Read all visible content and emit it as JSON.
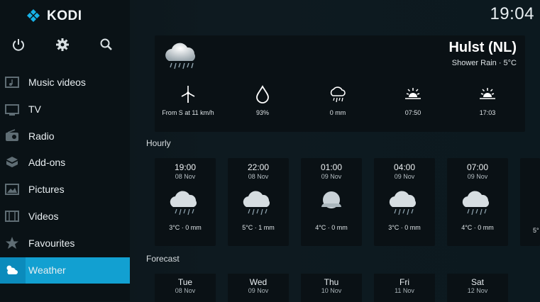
{
  "app": {
    "name": "KODI"
  },
  "clock": "19:04",
  "sidebar": {
    "items": [
      {
        "label": "Music videos",
        "icon": "music-video-icon"
      },
      {
        "label": "TV",
        "icon": "tv-icon"
      },
      {
        "label": "Radio",
        "icon": "radio-icon"
      },
      {
        "label": "Add-ons",
        "icon": "addons-icon"
      },
      {
        "label": "Pictures",
        "icon": "pictures-icon"
      },
      {
        "label": "Videos",
        "icon": "videos-icon"
      },
      {
        "label": "Favourites",
        "icon": "star-icon"
      },
      {
        "label": "Weather",
        "icon": "weather-icon",
        "active": true
      }
    ]
  },
  "current": {
    "city": "Hulst (NL)",
    "condition": "Shower Rain · 5°C",
    "stats": [
      {
        "icon": "wind-turbine-icon",
        "text": "From S at 11 km/h"
      },
      {
        "icon": "humidity-drop-icon",
        "text": "93%"
      },
      {
        "icon": "rain-cloud-icon",
        "text": "0 mm"
      },
      {
        "icon": "sunrise-icon",
        "text": "07:50"
      },
      {
        "icon": "sunset-icon",
        "text": "17:03"
      }
    ]
  },
  "sections": {
    "hourly": "Hourly",
    "forecast": "Forecast"
  },
  "hourly": [
    {
      "time": "19:00",
      "date": "08 Nov",
      "icon": "cloud-rain-icon",
      "value": "3°C · 0 mm"
    },
    {
      "time": "22:00",
      "date": "08 Nov",
      "icon": "cloud-rain-icon",
      "value": "5°C · 1 mm"
    },
    {
      "time": "01:00",
      "date": "09 Nov",
      "icon": "moon-cloud-icon",
      "value": "4°C · 0 mm"
    },
    {
      "time": "04:00",
      "date": "09 Nov",
      "icon": "cloud-rain-icon",
      "value": "3°C · 0 mm"
    },
    {
      "time": "07:00",
      "date": "09 Nov",
      "icon": "cloud-rain-icon",
      "value": "4°C · 0 mm"
    },
    {
      "time": "",
      "date": "",
      "icon": "cloud-rain-icon",
      "value": "5°"
    }
  ],
  "forecast": [
    {
      "day": "Tue",
      "date": "08 Nov"
    },
    {
      "day": "Wed",
      "date": "09 Nov"
    },
    {
      "day": "Thu",
      "date": "10 Nov"
    },
    {
      "day": "Fri",
      "date": "11 Nov"
    },
    {
      "day": "Sat",
      "date": "12 Nov"
    }
  ],
  "colors": {
    "accent": "#12a0d1",
    "panel": "#0a1115",
    "sidebar": "#0a1216"
  }
}
